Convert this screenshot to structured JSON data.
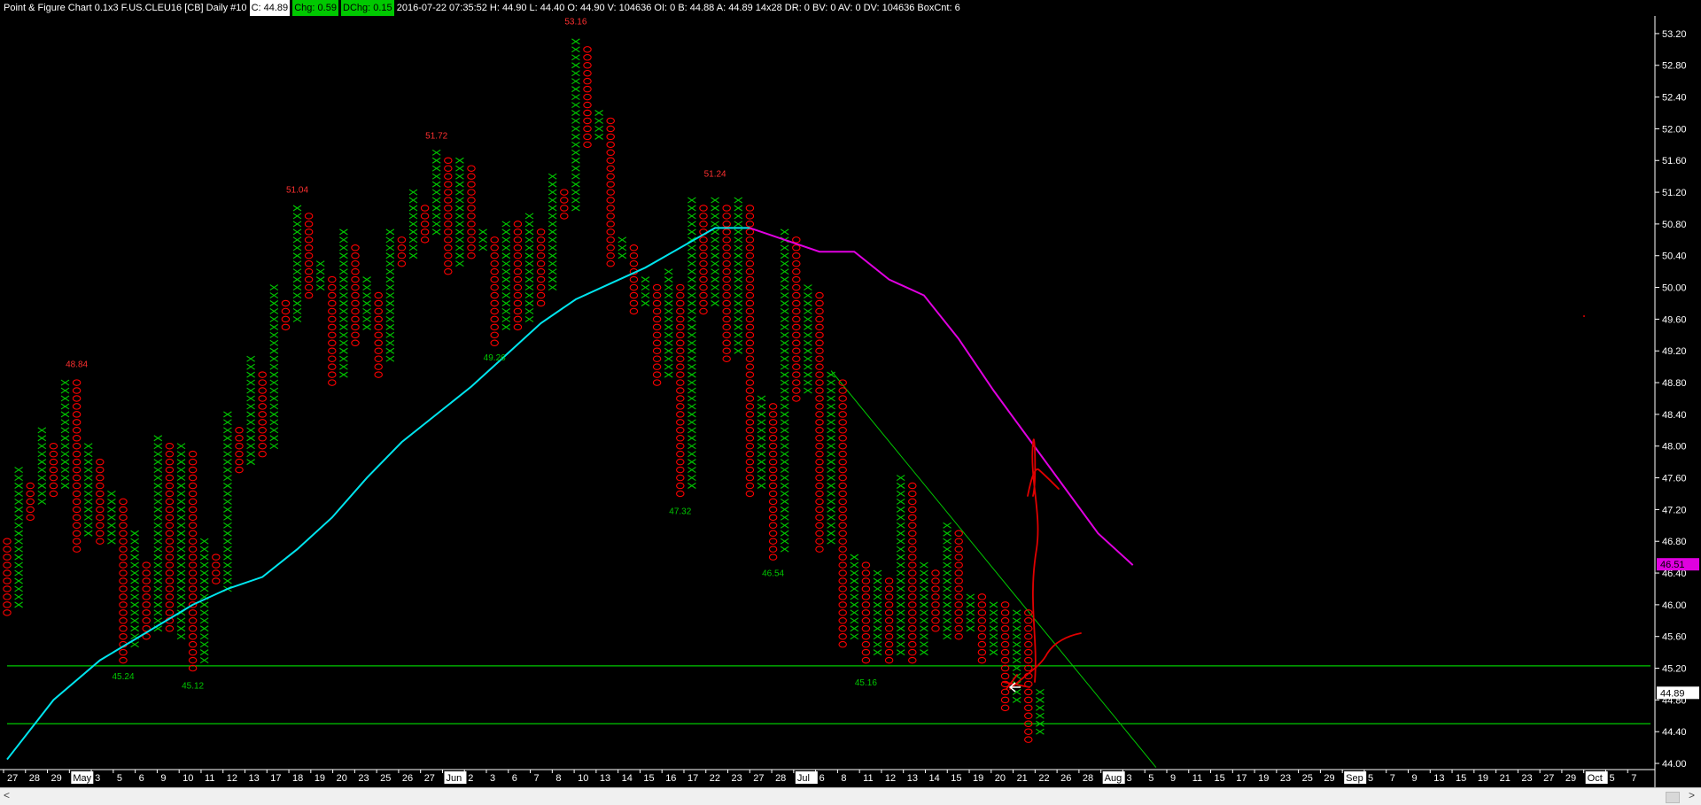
{
  "header": {
    "title": "Point & Figure Chart 0.1x3 F.US.CLEU16 [CB]  Daily  #10",
    "close": "C: 44.89",
    "chg": "Chg: 0.59",
    "dchg": "DChg: 0.15",
    "info": "2016-07-22 07:35:52  H: 44.90  L: 44.40  O: 44.90  V: 104636  OI: 0  B: 44.88  A: 44.89  14x28  DR: 0  BV: 0  AV: 0  DV: 104636  BoxCnt: 6"
  },
  "colors": {
    "x": "#00c800",
    "o": "#ff0000",
    "ma_up": "#00e5ee",
    "ma_down": "#e000e0",
    "lines": "#00c800",
    "annotation": "#e00000",
    "arrow": "#ffffff"
  },
  "scrollbar": {
    "left_arrow": "<",
    "right_arrow": ">"
  },
  "chart_data": {
    "type": "point-and-figure",
    "box_size": 0.1,
    "reversal": 3,
    "ylim": [
      43.9,
      53.4
    ],
    "y_ticks": [
      "44.00",
      "44.40",
      "44.80",
      "45.20",
      "45.60",
      "46.00",
      "46.40",
      "46.80",
      "47.20",
      "47.60",
      "48.00",
      "48.40",
      "48.80",
      "49.20",
      "49.60",
      "50.00",
      "50.40",
      "50.80",
      "51.20",
      "51.60",
      "52.00",
      "52.40",
      "52.80",
      "53.20"
    ],
    "price_badges": [
      {
        "label": "46.51",
        "value": 46.51,
        "color": "#e000e0"
      },
      {
        "label": "44.89",
        "value": 44.89,
        "color": "#ffffff"
      }
    ],
    "x_axis": {
      "labels": [
        "27",
        "28",
        "29",
        "May",
        "3",
        "5",
        "6",
        "9",
        "10",
        "11",
        "12",
        "13",
        "17",
        "18",
        "19",
        "20",
        "23",
        "25",
        "26",
        "27",
        "Jun",
        "2",
        "3",
        "6",
        "7",
        "8",
        "10",
        "13",
        "14",
        "15",
        "16",
        "17",
        "22",
        "23",
        "27",
        "28",
        "Jul",
        "6",
        "8",
        "11",
        "12",
        "13",
        "14",
        "15",
        "19",
        "20",
        "21",
        "22",
        "26",
        "28",
        "Aug",
        "3",
        "5",
        "9",
        "11",
        "15",
        "17",
        "19",
        "23",
        "25",
        "29",
        "Sep",
        "5",
        "7",
        "9",
        "13",
        "15",
        "19",
        "21",
        "23",
        "27",
        "29",
        "Oct",
        "5",
        "7"
      ],
      "highlight": [
        "May",
        "Jun",
        "Jul",
        "Aug",
        "Sep",
        "Oct"
      ]
    },
    "columns": [
      {
        "t": "O",
        "hi": 46.8,
        "lo": 45.9
      },
      {
        "t": "X",
        "hi": 47.7,
        "lo": 46.0
      },
      {
        "t": "O",
        "hi": 47.5,
        "lo": 47.1
      },
      {
        "t": "X",
        "hi": 48.2,
        "lo": 47.3
      },
      {
        "t": "O",
        "hi": 48.0,
        "lo": 47.4
      },
      {
        "t": "X",
        "hi": 48.8,
        "lo": 47.5
      },
      {
        "t": "O",
        "hi": 48.8,
        "lo": 46.7
      },
      {
        "t": "X",
        "hi": 48.0,
        "lo": 46.9
      },
      {
        "t": "O",
        "hi": 47.8,
        "lo": 46.8
      },
      {
        "t": "X",
        "hi": 47.4,
        "lo": 46.8
      },
      {
        "t": "O",
        "hi": 47.3,
        "lo": 45.3
      },
      {
        "t": "X",
        "hi": 46.9,
        "lo": 45.5
      },
      {
        "t": "O",
        "hi": 46.5,
        "lo": 45.6
      },
      {
        "t": "X",
        "hi": 48.1,
        "lo": 45.7
      },
      {
        "t": "O",
        "hi": 48.0,
        "lo": 45.7
      },
      {
        "t": "X",
        "hi": 48.0,
        "lo": 45.6
      },
      {
        "t": "O",
        "hi": 47.9,
        "lo": 45.2
      },
      {
        "t": "X",
        "hi": 46.8,
        "lo": 45.3
      },
      {
        "t": "O",
        "hi": 46.6,
        "lo": 46.3
      },
      {
        "t": "X",
        "hi": 48.4,
        "lo": 46.2
      },
      {
        "t": "O",
        "hi": 48.2,
        "lo": 47.7
      },
      {
        "t": "X",
        "hi": 49.1,
        "lo": 47.8
      },
      {
        "t": "O",
        "hi": 48.9,
        "lo": 47.9
      },
      {
        "t": "X",
        "hi": 50.0,
        "lo": 48.0
      },
      {
        "t": "O",
        "hi": 49.8,
        "lo": 49.5
      },
      {
        "t": "X",
        "hi": 51.0,
        "lo": 49.6
      },
      {
        "t": "O",
        "hi": 50.9,
        "lo": 49.9
      },
      {
        "t": "X",
        "hi": 50.3,
        "lo": 50.0
      },
      {
        "t": "O",
        "hi": 50.1,
        "lo": 48.8
      },
      {
        "t": "X",
        "hi": 50.7,
        "lo": 48.9
      },
      {
        "t": "O",
        "hi": 50.5,
        "lo": 49.3
      },
      {
        "t": "X",
        "hi": 50.1,
        "lo": 49.5
      },
      {
        "t": "O",
        "hi": 49.9,
        "lo": 48.9
      },
      {
        "t": "X",
        "hi": 50.7,
        "lo": 49.1
      },
      {
        "t": "O",
        "hi": 50.6,
        "lo": 50.3
      },
      {
        "t": "X",
        "hi": 51.2,
        "lo": 50.4
      },
      {
        "t": "O",
        "hi": 51.0,
        "lo": 50.6
      },
      {
        "t": "X",
        "hi": 51.7,
        "lo": 50.7
      },
      {
        "t": "O",
        "hi": 51.6,
        "lo": 50.2
      },
      {
        "t": "X",
        "hi": 51.6,
        "lo": 50.3
      },
      {
        "t": "O",
        "hi": 51.5,
        "lo": 50.4
      },
      {
        "t": "X",
        "hi": 50.7,
        "lo": 50.5
      },
      {
        "t": "O",
        "hi": 50.6,
        "lo": 49.3
      },
      {
        "t": "X",
        "hi": 50.8,
        "lo": 49.5
      },
      {
        "t": "O",
        "hi": 50.8,
        "lo": 49.5
      },
      {
        "t": "X",
        "hi": 50.9,
        "lo": 49.6
      },
      {
        "t": "O",
        "hi": 50.7,
        "lo": 49.8
      },
      {
        "t": "X",
        "hi": 51.4,
        "lo": 50.0
      },
      {
        "t": "O",
        "hi": 51.2,
        "lo": 50.9
      },
      {
        "t": "X",
        "hi": 53.1,
        "lo": 51.0
      },
      {
        "t": "O",
        "hi": 53.0,
        "lo": 51.8
      },
      {
        "t": "X",
        "hi": 52.2,
        "lo": 51.9
      },
      {
        "t": "O",
        "hi": 52.1,
        "lo": 50.3
      },
      {
        "t": "X",
        "hi": 50.6,
        "lo": 50.4
      },
      {
        "t": "O",
        "hi": 50.5,
        "lo": 49.7
      },
      {
        "t": "X",
        "hi": 50.1,
        "lo": 49.8
      },
      {
        "t": "O",
        "hi": 50.0,
        "lo": 48.8
      },
      {
        "t": "X",
        "hi": 50.2,
        "lo": 48.9
      },
      {
        "t": "O",
        "hi": 50.0,
        "lo": 47.4
      },
      {
        "t": "X",
        "hi": 51.1,
        "lo": 47.5
      },
      {
        "t": "O",
        "hi": 51.0,
        "lo": 49.7
      },
      {
        "t": "X",
        "hi": 51.1,
        "lo": 49.8
      },
      {
        "t": "O",
        "hi": 51.0,
        "lo": 49.1
      },
      {
        "t": "X",
        "hi": 51.1,
        "lo": 49.2
      },
      {
        "t": "O",
        "hi": 51.0,
        "lo": 47.4
      },
      {
        "t": "X",
        "hi": 48.6,
        "lo": 47.5
      },
      {
        "t": "O",
        "hi": 48.5,
        "lo": 46.6
      },
      {
        "t": "X",
        "hi": 50.7,
        "lo": 46.7
      },
      {
        "t": "O",
        "hi": 50.6,
        "lo": 48.6
      },
      {
        "t": "X",
        "hi": 50.0,
        "lo": 48.7
      },
      {
        "t": "O",
        "hi": 49.9,
        "lo": 46.7
      },
      {
        "t": "X",
        "hi": 48.9,
        "lo": 46.8
      },
      {
        "t": "O",
        "hi": 48.8,
        "lo": 45.5
      },
      {
        "t": "X",
        "hi": 46.6,
        "lo": 45.6
      },
      {
        "t": "O",
        "hi": 46.5,
        "lo": 45.3
      },
      {
        "t": "X",
        "hi": 46.4,
        "lo": 45.4
      },
      {
        "t": "O",
        "hi": 46.3,
        "lo": 45.3
      },
      {
        "t": "X",
        "hi": 47.6,
        "lo": 45.4
      },
      {
        "t": "O",
        "hi": 47.5,
        "lo": 45.3
      },
      {
        "t": "X",
        "hi": 46.5,
        "lo": 45.4
      },
      {
        "t": "O",
        "hi": 46.4,
        "lo": 45.7
      },
      {
        "t": "X",
        "hi": 47.0,
        "lo": 45.6
      },
      {
        "t": "O",
        "hi": 46.9,
        "lo": 45.6
      },
      {
        "t": "X",
        "hi": 46.1,
        "lo": 45.7
      },
      {
        "t": "O",
        "hi": 46.1,
        "lo": 45.3
      },
      {
        "t": "X",
        "hi": 46.0,
        "lo": 45.4
      },
      {
        "t": "O",
        "hi": 46.0,
        "lo": 44.7
      },
      {
        "t": "X",
        "hi": 45.9,
        "lo": 44.8
      },
      {
        "t": "O",
        "hi": 45.9,
        "lo": 44.3
      },
      {
        "t": "X",
        "hi": 44.9,
        "lo": 44.4
      }
    ],
    "value_labels": [
      {
        "text": "48.84",
        "col": 6,
        "value": 48.84,
        "pos": "above",
        "color": "#ff3030"
      },
      {
        "text": "51.04",
        "col": 25,
        "value": 51.04,
        "pos": "above",
        "color": "#ff3030"
      },
      {
        "text": "51.72",
        "col": 37,
        "value": 51.72,
        "pos": "above",
        "color": "#ff3030"
      },
      {
        "text": "53.16",
        "col": 49,
        "value": 53.16,
        "pos": "above",
        "color": "#ff3030"
      },
      {
        "text": "51.24",
        "col": 61,
        "value": 51.24,
        "pos": "above",
        "color": "#ff3030"
      },
      {
        "text": "45.24",
        "col": 10,
        "value": 45.24,
        "pos": "below",
        "color": "#00c800"
      },
      {
        "text": "45.12",
        "col": 16,
        "value": 45.12,
        "pos": "below",
        "color": "#00c800"
      },
      {
        "text": "49.26",
        "col": 42,
        "value": 49.26,
        "pos": "below",
        "color": "#00c800"
      },
      {
        "text": "47.32",
        "col": 58,
        "value": 47.32,
        "pos": "below",
        "color": "#00c800"
      },
      {
        "text": "46.54",
        "col": 66,
        "value": 46.54,
        "pos": "below",
        "color": "#00c800"
      },
      {
        "text": "45.16",
        "col": 74,
        "value": 45.16,
        "pos": "below",
        "color": "#00c800"
      }
    ],
    "horizontal_lines": [
      45.23,
      44.5
    ],
    "trend_line": {
      "from": {
        "col": 71,
        "value": 48.95
      },
      "to": {
        "col": 99,
        "value": 43.95
      }
    },
    "moving_average": [
      {
        "col": 0,
        "v": 44.05
      },
      {
        "col": 4,
        "v": 44.8
      },
      {
        "col": 8,
        "v": 45.3
      },
      {
        "col": 12,
        "v": 45.65
      },
      {
        "col": 16,
        "v": 46.0
      },
      {
        "col": 19,
        "v": 46.2
      },
      {
        "col": 22,
        "v": 46.35
      },
      {
        "col": 25,
        "v": 46.7
      },
      {
        "col": 28,
        "v": 47.1
      },
      {
        "col": 31,
        "v": 47.6
      },
      {
        "col": 34,
        "v": 48.05
      },
      {
        "col": 37,
        "v": 48.4
      },
      {
        "col": 40,
        "v": 48.75
      },
      {
        "col": 43,
        "v": 49.15
      },
      {
        "col": 46,
        "v": 49.55
      },
      {
        "col": 49,
        "v": 49.85
      },
      {
        "col": 52,
        "v": 50.05
      },
      {
        "col": 55,
        "v": 50.25
      },
      {
        "col": 58,
        "v": 50.5
      },
      {
        "col": 61,
        "v": 50.75
      },
      {
        "col": 64,
        "v": 50.75
      },
      {
        "col": 67,
        "v": 50.6
      },
      {
        "col": 70,
        "v": 50.45
      },
      {
        "col": 73,
        "v": 50.45
      },
      {
        "col": 76,
        "v": 50.1
      },
      {
        "col": 79,
        "v": 49.9
      },
      {
        "col": 82,
        "v": 49.35
      },
      {
        "col": 85,
        "v": 48.7
      },
      {
        "col": 88,
        "v": 48.1
      },
      {
        "col": 91,
        "v": 47.5
      },
      {
        "col": 94,
        "v": 46.9
      },
      {
        "col": 97,
        "v": 46.5
      }
    ],
    "ma_color_switch_col": 64
  }
}
